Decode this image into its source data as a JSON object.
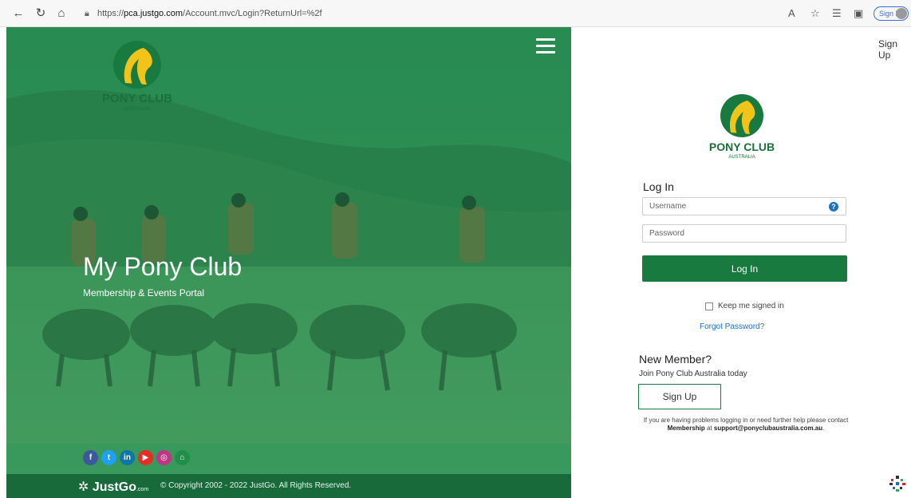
{
  "browser": {
    "url_prefix": "https://",
    "url_host": "pca.justgo.com",
    "url_path": "/Account.mvc/Login?ReturnUrl=%2f",
    "signin_label": "Sign in"
  },
  "hero": {
    "logo_text": "PONY CLUB",
    "logo_subtext": "AUSTRALIA",
    "title": "My Pony Club",
    "subtitle": "Membership & Events Portal",
    "social": [
      {
        "name": "facebook",
        "glyph": "f",
        "color": "#3b5998"
      },
      {
        "name": "twitter",
        "glyph": "t",
        "color": "#1da1f2"
      },
      {
        "name": "linkedin",
        "glyph": "in",
        "color": "#0e76a8"
      },
      {
        "name": "youtube",
        "glyph": "▶",
        "color": "#e52d27"
      },
      {
        "name": "instagram",
        "glyph": "◎",
        "color": "#c13584"
      },
      {
        "name": "home",
        "glyph": "⌂",
        "color": "#1f8f4a"
      }
    ],
    "footer_brand": "JustGo",
    "footer_brand_suffix": ".com",
    "copyright": "© Copyright 2002 - 2022 JustGo. All Rights Reserved."
  },
  "login": {
    "top_signup": "Sign Up",
    "logo_text": "PONY CLUB",
    "logo_subtext": "AUSTRALIA",
    "heading": "Log In",
    "username_placeholder": "Username",
    "password_placeholder": "Password",
    "login_button": "Log In",
    "keep_signed_in": "Keep me signed in",
    "forgot_password": "Forgot Password?",
    "new_member_heading": "New Member?",
    "join_text": "Join Pony Club Australia today",
    "signup_button": "Sign Up",
    "help_pre": "If you are having problems logging in or need further help please contact ",
    "help_membership": "Membership",
    "help_mid": " at ",
    "help_email": "support@ponyclubaustralia.com.au",
    "help_post": "."
  },
  "colors": {
    "brand_green": "#187a3f",
    "logo_yellow": "#f2c318",
    "link_blue": "#1a6fcf"
  }
}
